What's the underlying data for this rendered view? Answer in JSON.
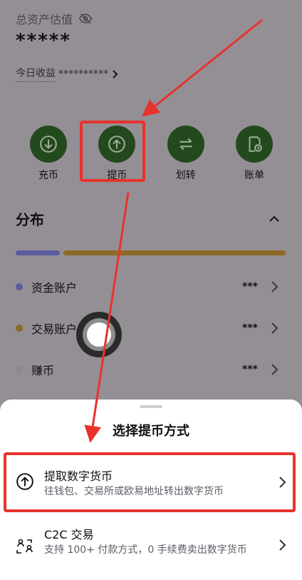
{
  "header": {
    "asset_label": "总资产估值",
    "asset_value": "*****",
    "today_label": "今日收益",
    "today_value": "**********"
  },
  "actions": [
    {
      "label": "充币",
      "icon": "download-icon"
    },
    {
      "label": "提币",
      "icon": "upload-icon"
    },
    {
      "label": "划转",
      "icon": "transfer-icon"
    },
    {
      "label": "账单",
      "icon": "bill-icon"
    }
  ],
  "distribution": {
    "title": "分布",
    "accounts": [
      {
        "name": "资金账户",
        "value": "***",
        "color": "#5c5b9e"
      },
      {
        "name": "交易账户",
        "value": "***",
        "color": "#8d6a26"
      },
      {
        "name": "赚币",
        "value": "***",
        "color": "#8a8a8a"
      }
    ]
  },
  "sheet": {
    "title": "选择提币方式",
    "options": [
      {
        "title": "提取数字货币",
        "subtitle": "往钱包、交易所或欧易地址转出数字货币",
        "icon": "upload-icon"
      },
      {
        "title": "C2C 交易",
        "subtitle": "支持 100+ 付款方式，0 手续费卖出数字货币",
        "icon": "people-exchange-icon"
      }
    ]
  },
  "colors": {
    "overlay": "#948f95",
    "action_circle": "#25491f",
    "highlight": "#e8322c"
  }
}
